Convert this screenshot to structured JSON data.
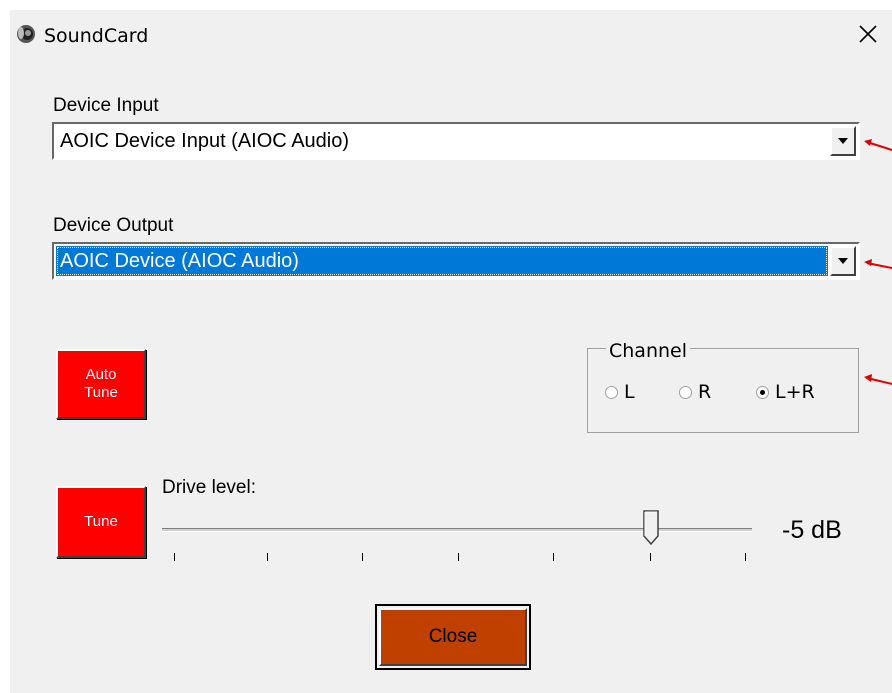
{
  "window": {
    "title": "SoundCard"
  },
  "device_input": {
    "label": "Device Input",
    "selected": "AOIC Device Input (AIOC Audio)"
  },
  "device_output": {
    "label": "Device Output",
    "selected": "AOIC Device (AIOC Audio)"
  },
  "buttons": {
    "auto_tune": "Auto\nTune",
    "tune": "Tune",
    "close": "Close"
  },
  "channel": {
    "title": "Channel",
    "options": [
      {
        "label": "L",
        "selected": false
      },
      {
        "label": "R",
        "selected": false
      },
      {
        "label": "L+R",
        "selected": true
      }
    ]
  },
  "drive": {
    "label": "Drive level:",
    "value_text": "-5 dB",
    "slider_level": 0.83,
    "tick_count": 7
  },
  "colors": {
    "window_bg": "#f0f0f0",
    "selection": "#0078d7",
    "tune_button": "#ff0000",
    "close_button": "#c04000",
    "annotation_arrow": "#e00000"
  }
}
